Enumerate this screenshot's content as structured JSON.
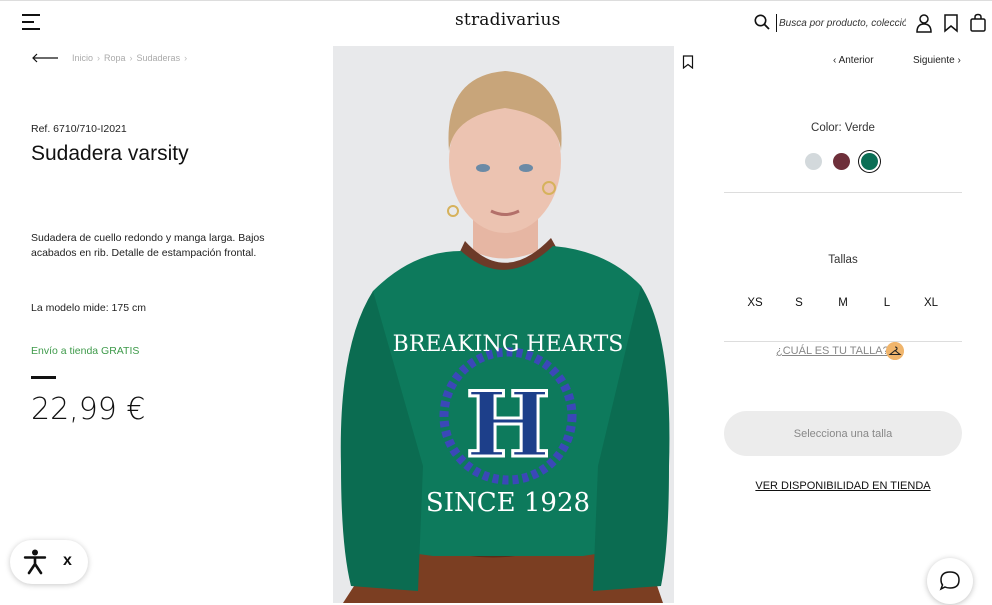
{
  "header": {
    "logo": "stradivarius",
    "search_placeholder": "Busca por producto, colección..."
  },
  "breadcrumb": [
    "Inicio",
    "Ropa",
    "Sudaderas"
  ],
  "breadcrumb_sep": "›",
  "product": {
    "ref": "Ref. 6710/710-I2021",
    "title": "Sudadera varsity",
    "description": "Sudadera de cuello redondo y manga larga. Bajos acabados en rib. Detalle de estampación frontal.",
    "model_height": "La modelo mide: 175 cm",
    "shipping": "Envío a tienda GRATIS",
    "price": "22,99 €"
  },
  "image_print": {
    "top_text": "BREAKING HEARTS",
    "letter": "H",
    "bottom_text": "SINCE 1928"
  },
  "nav": {
    "prev": "Anterior",
    "next": "Siguiente"
  },
  "color": {
    "label": "Color: Verde",
    "swatches": [
      {
        "name": "Gris",
        "hex": "#d3d9dc"
      },
      {
        "name": "Burdeos",
        "hex": "#6e2f3a"
      },
      {
        "name": "Verde",
        "hex": "#0b6e55",
        "selected": true
      }
    ]
  },
  "sizes": {
    "label": "Tallas",
    "options": [
      "XS",
      "S",
      "M",
      "L",
      "XL"
    ],
    "guide": "¿CUÁL ES TU TALLA?"
  },
  "cta": {
    "select_size": "Selecciona una talla",
    "store_availability": "VER DISPONIBILIDAD EN TIENDA"
  },
  "accessibility": {
    "close": "x"
  },
  "colors": {
    "shipping_green": "#3e9a4a",
    "sweater_green": "#0d7a5c",
    "guide_badge": "#f0b56c"
  }
}
